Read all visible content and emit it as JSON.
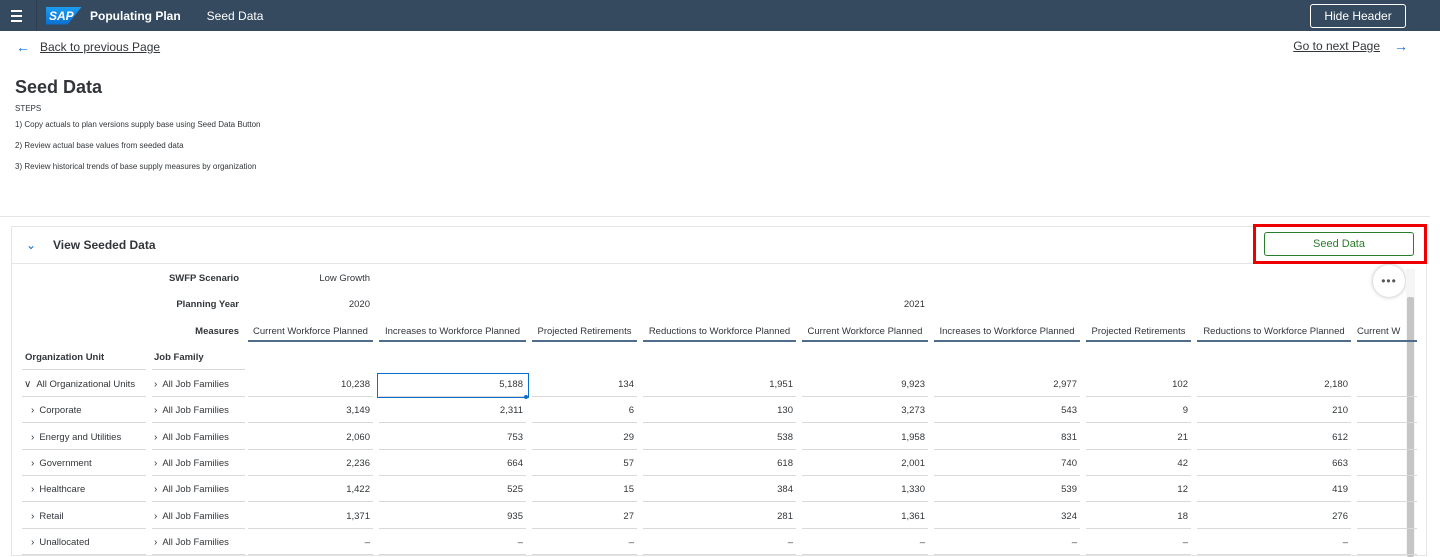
{
  "shell": {
    "app_title": "Populating Plan",
    "app_subtitle": "Seed Data",
    "logo_text": "SAP",
    "hide_header_label": "Hide Header"
  },
  "nav": {
    "back_label": "Back to previous Page",
    "next_label": "Go to next Page"
  },
  "page": {
    "title": "Seed Data",
    "steps_heading": "STEPS",
    "steps": [
      "1) Copy actuals to plan versions supply base using Seed Data Button",
      "2) Review actual base values from seeded data",
      "3) Review historical trends of base supply measures by organization"
    ]
  },
  "panel": {
    "title": "View Seeded Data",
    "seed_button_label": "Seed Data",
    "more_label": "•••"
  },
  "table": {
    "scenario_label": "SWFP Scenario",
    "scenario_value": "Low Growth",
    "year_label": "Planning Year",
    "years": [
      "2020",
      "2021"
    ],
    "measures_label": "Measures",
    "org_header": "Organization Unit",
    "job_header": "Job Family",
    "measures": [
      "Current Workforce Planned",
      "Increases to Workforce Planned",
      "Projected Retirements",
      "Reductions to Workforce Planned",
      "Current Workforce Planned",
      "Increases to Workforce Planned",
      "Projected Retirements",
      "Reductions to Workforce Planned",
      "Current W"
    ],
    "rows": [
      {
        "org": "All Organizational Units",
        "job": "All Job Families",
        "values": [
          "10,238",
          "5,188",
          "134",
          "1,951",
          "9,923",
          "2,977",
          "102",
          "2,180"
        ]
      },
      {
        "org": "Corporate",
        "job": "All Job Families",
        "values": [
          "3,149",
          "2,311",
          "6",
          "130",
          "3,273",
          "543",
          "9",
          "210"
        ]
      },
      {
        "org": "Energy and Utilities",
        "job": "All Job Families",
        "values": [
          "2,060",
          "753",
          "29",
          "538",
          "1,958",
          "831",
          "21",
          "612"
        ]
      },
      {
        "org": "Government",
        "job": "All Job Families",
        "values": [
          "2,236",
          "664",
          "57",
          "618",
          "2,001",
          "740",
          "42",
          "663"
        ]
      },
      {
        "org": "Healthcare",
        "job": "All Job Families",
        "values": [
          "1,422",
          "525",
          "15",
          "384",
          "1,330",
          "539",
          "12",
          "419"
        ]
      },
      {
        "org": "Retail",
        "job": "All Job Families",
        "values": [
          "1,371",
          "935",
          "27",
          "281",
          "1,361",
          "324",
          "18",
          "276"
        ]
      },
      {
        "org": "Unallocated",
        "job": "All Job Families",
        "values": [
          "–",
          "–",
          "–",
          "–",
          "–",
          "–",
          "–",
          "–"
        ]
      }
    ]
  },
  "colors": {
    "shell_bg": "#354a5f",
    "accent": "#0a6ed1",
    "seed_button": "#2b7c2b",
    "highlight": "#e00000"
  }
}
